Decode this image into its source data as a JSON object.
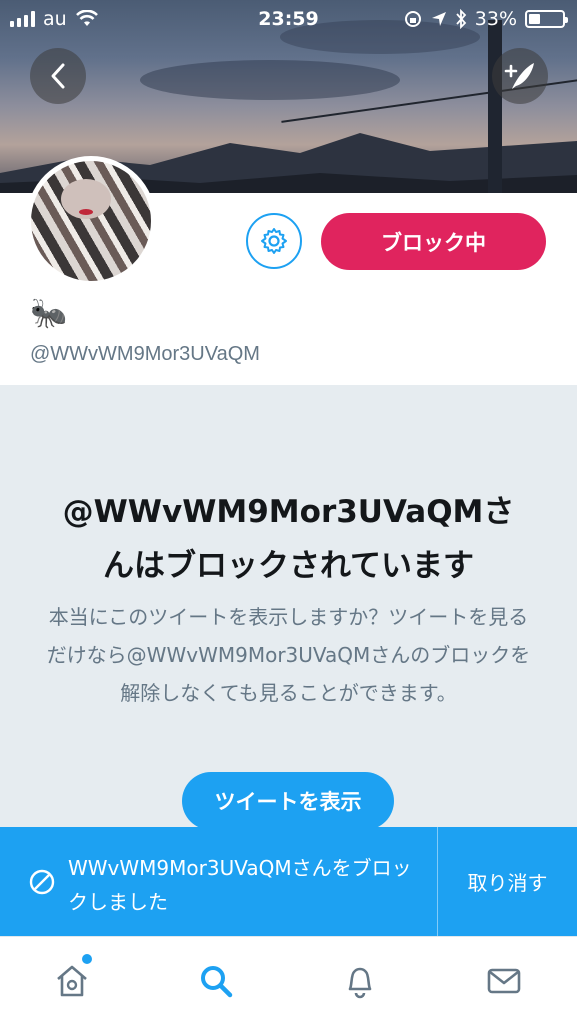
{
  "status_bar": {
    "carrier": "au",
    "time": "23:59",
    "battery_percent": "33%",
    "signal_bars": 4,
    "battery_level": 0.33
  },
  "header": {
    "back_icon": "chevron-left-icon",
    "compose_icon": "compose-tweet-icon"
  },
  "profile": {
    "name": "🐜",
    "handle": "@WWvWM9Mor3UVaQM",
    "block_button_label": "ブロック中",
    "settings_icon": "gear-icon"
  },
  "blocked_notice": {
    "title_line1": "@WWvWM9Mor3UVaQMさ",
    "title_line2": "んはブロックされています",
    "description": "本当にこのツイートを表示しますか？ツイートを見るだけなら@WWvWM9Mor3UVaQMさんのブロックを解除しなくても見ることができます。",
    "show_button_label": "ツイートを表示"
  },
  "toast": {
    "message": "WWvWM9Mor3UVaQMさんをブロックしました",
    "undo_label": "取り消す",
    "icon": "block-icon"
  },
  "tabbar": {
    "items": [
      {
        "icon": "home-icon",
        "active": false,
        "has_badge": true
      },
      {
        "icon": "search-icon",
        "active": true,
        "has_badge": false
      },
      {
        "icon": "notifications-icon",
        "active": false,
        "has_badge": false
      },
      {
        "icon": "messages-icon",
        "active": false,
        "has_badge": false
      }
    ]
  },
  "colors": {
    "accent": "#1da1f2",
    "block_red": "#e0245e",
    "panel_bg": "#e6ecf0",
    "secondary_text": "#657786",
    "tab_icon": "#657786"
  }
}
